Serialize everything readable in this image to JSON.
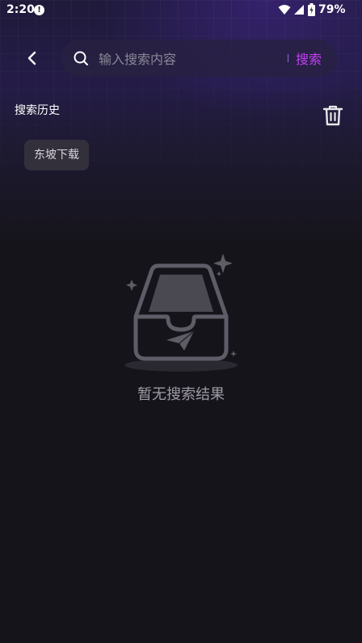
{
  "status_bar": {
    "time": "2:20",
    "battery": "79%"
  },
  "search": {
    "placeholder": "输入搜索内容",
    "value": "",
    "submit_label": "搜索"
  },
  "history": {
    "title": "搜索历史",
    "items": [
      "东坡下载"
    ]
  },
  "empty_state": {
    "message": "暂无搜索结果"
  },
  "colors": {
    "accent": "#c040f0",
    "background": "#16141b",
    "chip": "#33303c"
  },
  "icons": {
    "back": "chevron-left-icon",
    "search": "search-icon",
    "trash": "trash-icon",
    "empty": "empty-inbox-icon"
  }
}
